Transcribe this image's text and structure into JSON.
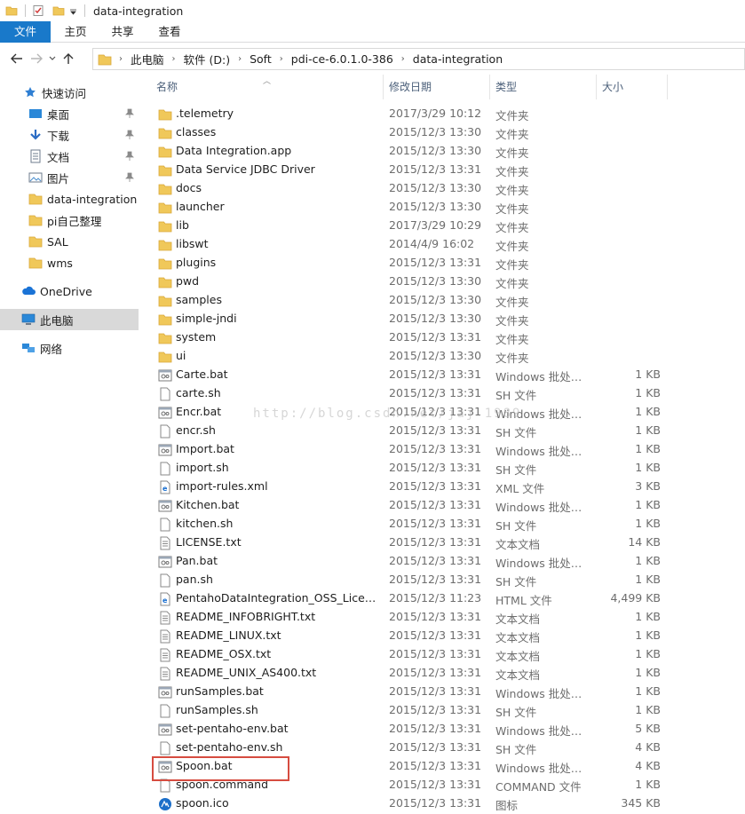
{
  "window": {
    "title": "data-integration"
  },
  "ribbon": {
    "tabs": [
      {
        "label": "文件"
      },
      {
        "label": "主页"
      },
      {
        "label": "共享"
      },
      {
        "label": "查看"
      }
    ]
  },
  "address": {
    "crumbs": [
      "此电脑",
      "软件 (D:)",
      "Soft",
      "pdi-ce-6.0.1.0-386",
      "data-integration"
    ]
  },
  "sidebar": {
    "quick_access": "快速访问",
    "items": [
      {
        "label": "桌面",
        "icon": "desktop-icon",
        "pinned": true
      },
      {
        "label": "下载",
        "icon": "download-icon",
        "pinned": true
      },
      {
        "label": "文档",
        "icon": "documents-icon",
        "pinned": true
      },
      {
        "label": "图片",
        "icon": "pictures-icon",
        "pinned": true
      },
      {
        "label": "data-integration",
        "icon": "folder-icon",
        "pinned": false
      },
      {
        "label": "pi自己整理",
        "icon": "folder-icon",
        "pinned": false
      },
      {
        "label": "SAL",
        "icon": "folder-icon",
        "pinned": false
      },
      {
        "label": "wms",
        "icon": "folder-icon",
        "pinned": false
      }
    ],
    "onedrive": "OneDrive",
    "this_pc": "此电脑",
    "network": "网络"
  },
  "columns": {
    "name": "名称",
    "date": "修改日期",
    "type": "类型",
    "size": "大小"
  },
  "watermark": "http://blog.csdn.net/jaj 1989",
  "files": [
    {
      "name": ".telemetry",
      "date": "2017/3/29 10:12",
      "type": "文件夹",
      "size": "",
      "kind": "folder"
    },
    {
      "name": "classes",
      "date": "2015/12/3 13:30",
      "type": "文件夹",
      "size": "",
      "kind": "folder"
    },
    {
      "name": "Data Integration.app",
      "date": "2015/12/3 13:30",
      "type": "文件夹",
      "size": "",
      "kind": "folder"
    },
    {
      "name": "Data Service JDBC Driver",
      "date": "2015/12/3 13:31",
      "type": "文件夹",
      "size": "",
      "kind": "folder"
    },
    {
      "name": "docs",
      "date": "2015/12/3 13:30",
      "type": "文件夹",
      "size": "",
      "kind": "folder"
    },
    {
      "name": "launcher",
      "date": "2015/12/3 13:30",
      "type": "文件夹",
      "size": "",
      "kind": "folder"
    },
    {
      "name": "lib",
      "date": "2017/3/29 10:29",
      "type": "文件夹",
      "size": "",
      "kind": "folder"
    },
    {
      "name": "libswt",
      "date": "2014/4/9 16:02",
      "type": "文件夹",
      "size": "",
      "kind": "folder"
    },
    {
      "name": "plugins",
      "date": "2015/12/3 13:31",
      "type": "文件夹",
      "size": "",
      "kind": "folder"
    },
    {
      "name": "pwd",
      "date": "2015/12/3 13:30",
      "type": "文件夹",
      "size": "",
      "kind": "folder"
    },
    {
      "name": "samples",
      "date": "2015/12/3 13:30",
      "type": "文件夹",
      "size": "",
      "kind": "folder"
    },
    {
      "name": "simple-jndi",
      "date": "2015/12/3 13:30",
      "type": "文件夹",
      "size": "",
      "kind": "folder"
    },
    {
      "name": "system",
      "date": "2015/12/3 13:31",
      "type": "文件夹",
      "size": "",
      "kind": "folder"
    },
    {
      "name": "ui",
      "date": "2015/12/3 13:30",
      "type": "文件夹",
      "size": "",
      "kind": "folder"
    },
    {
      "name": "Carte.bat",
      "date": "2015/12/3 13:31",
      "type": "Windows 批处理...",
      "size": "1 KB",
      "kind": "bat"
    },
    {
      "name": "carte.sh",
      "date": "2015/12/3 13:31",
      "type": "SH 文件",
      "size": "1 KB",
      "kind": "file"
    },
    {
      "name": "Encr.bat",
      "date": "2015/12/3 13:31",
      "type": "Windows 批处理...",
      "size": "1 KB",
      "kind": "bat"
    },
    {
      "name": "encr.sh",
      "date": "2015/12/3 13:31",
      "type": "SH 文件",
      "size": "1 KB",
      "kind": "file"
    },
    {
      "name": "Import.bat",
      "date": "2015/12/3 13:31",
      "type": "Windows 批处理...",
      "size": "1 KB",
      "kind": "bat"
    },
    {
      "name": "import.sh",
      "date": "2015/12/3 13:31",
      "type": "SH 文件",
      "size": "1 KB",
      "kind": "file"
    },
    {
      "name": "import-rules.xml",
      "date": "2015/12/3 13:31",
      "type": "XML 文件",
      "size": "3 KB",
      "kind": "web"
    },
    {
      "name": "Kitchen.bat",
      "date": "2015/12/3 13:31",
      "type": "Windows 批处理...",
      "size": "1 KB",
      "kind": "bat"
    },
    {
      "name": "kitchen.sh",
      "date": "2015/12/3 13:31",
      "type": "SH 文件",
      "size": "1 KB",
      "kind": "file"
    },
    {
      "name": "LICENSE.txt",
      "date": "2015/12/3 13:31",
      "type": "文本文档",
      "size": "14 KB",
      "kind": "txt"
    },
    {
      "name": "Pan.bat",
      "date": "2015/12/3 13:31",
      "type": "Windows 批处理...",
      "size": "1 KB",
      "kind": "bat"
    },
    {
      "name": "pan.sh",
      "date": "2015/12/3 13:31",
      "type": "SH 文件",
      "size": "1 KB",
      "kind": "file"
    },
    {
      "name": "PentahoDataIntegration_OSS_License...",
      "date": "2015/12/3 11:23",
      "type": "HTML 文件",
      "size": "4,499 KB",
      "kind": "web"
    },
    {
      "name": "README_INFOBRIGHT.txt",
      "date": "2015/12/3 13:31",
      "type": "文本文档",
      "size": "1 KB",
      "kind": "txt"
    },
    {
      "name": "README_LINUX.txt",
      "date": "2015/12/3 13:31",
      "type": "文本文档",
      "size": "1 KB",
      "kind": "txt"
    },
    {
      "name": "README_OSX.txt",
      "date": "2015/12/3 13:31",
      "type": "文本文档",
      "size": "1 KB",
      "kind": "txt"
    },
    {
      "name": "README_UNIX_AS400.txt",
      "date": "2015/12/3 13:31",
      "type": "文本文档",
      "size": "1 KB",
      "kind": "txt"
    },
    {
      "name": "runSamples.bat",
      "date": "2015/12/3 13:31",
      "type": "Windows 批处理...",
      "size": "1 KB",
      "kind": "bat"
    },
    {
      "name": "runSamples.sh",
      "date": "2015/12/3 13:31",
      "type": "SH 文件",
      "size": "1 KB",
      "kind": "file"
    },
    {
      "name": "set-pentaho-env.bat",
      "date": "2015/12/3 13:31",
      "type": "Windows 批处理...",
      "size": "5 KB",
      "kind": "bat"
    },
    {
      "name": "set-pentaho-env.sh",
      "date": "2015/12/3 13:31",
      "type": "SH 文件",
      "size": "4 KB",
      "kind": "file"
    },
    {
      "name": "Spoon.bat",
      "date": "2015/12/3 13:31",
      "type": "Windows 批处理...",
      "size": "4 KB",
      "kind": "bat",
      "highlighted": true
    },
    {
      "name": "spoon.command",
      "date": "2015/12/3 13:31",
      "type": "COMMAND 文件",
      "size": "1 KB",
      "kind": "file"
    },
    {
      "name": "spoon.ico",
      "date": "2015/12/3 13:31",
      "type": "图标",
      "size": "345 KB",
      "kind": "ico"
    }
  ]
}
